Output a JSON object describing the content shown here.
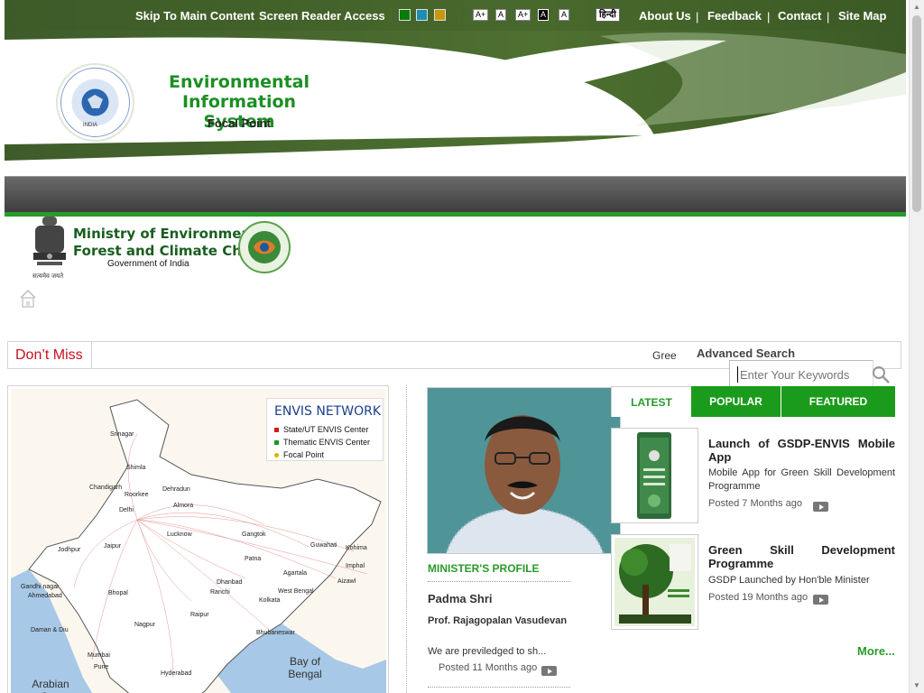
{
  "topbar": {
    "skip": "Skip To Main Content",
    "screen_reader": "Screen Reader Access",
    "themes": [
      "#0a7a0a",
      "#1a8fb0",
      "#c8960e"
    ],
    "font_controls": [
      "A+",
      "A",
      "A+",
      "A",
      "A"
    ],
    "hindi": "हिन्दी",
    "links": [
      "About Us",
      "Feedback",
      "Contact",
      "Site Map"
    ],
    "separator": "|"
  },
  "header": {
    "title": "Environmental Information System",
    "subtitle": "Focal Point",
    "logo_text": "Environmental Information System",
    "logo_country": "INDIA"
  },
  "ministry": {
    "name_line1": "Ministry of Environment,",
    "name_line2": "Forest and Climate Change",
    "government": "Government of India",
    "motto": "सत्यमेव जयते"
  },
  "dont_miss": {
    "label": "Don’t Miss",
    "ticker": "Gree"
  },
  "search": {
    "advanced": "Advanced Search",
    "placeholder": "Enter Your Keywords"
  },
  "map": {
    "legend_title": "ENVIS NETWORK",
    "legend": [
      {
        "label": "State/UT ENVIS Center",
        "color": "#d21a1a"
      },
      {
        "label": "Thematic ENVIS Center",
        "color": "#1a9a1a"
      },
      {
        "label": "Focal Point",
        "color": "#e0b000"
      }
    ],
    "cities": [
      "Srinagar",
      "Shimla",
      "Chandigarh",
      "Dehradun",
      "Roorkee",
      "Almora",
      "Delhi",
      "Jodhpur",
      "Jaipur",
      "Lucknow",
      "Gangtok",
      "Guwahati",
      "Kohima",
      "Patna",
      "Imphal",
      "Agartala",
      "Aizawl",
      "Gandhi nagar",
      "Ahmedabad",
      "Bhopal",
      "Dhanbad",
      "Ranchi",
      "West Bengal",
      "Kolkata",
      "Raipur",
      "Nagpur",
      "Bhubaneswar",
      "Daman & Diu",
      "Mumbai",
      "Pune",
      "Hyderabad"
    ],
    "seas": [
      "Bay of Bengal",
      "Arabian Sea"
    ]
  },
  "minister": {
    "section_label": "MINISTER'S PROFILE",
    "title": "Padma Shri",
    "name": "Prof. Rajagopalan Vasudevan",
    "desc": "We are previledged to sh...",
    "posted": "Posted 11 Months ago"
  },
  "tabs": [
    "LATEST",
    "POPULAR",
    "FEATURED"
  ],
  "news": [
    {
      "title": "Launch of GSDP-ENVIS Mobile App",
      "desc": "Mobile App for Green Skill Development Programme",
      "posted": "Posted 7 Months ago"
    },
    {
      "title": "Green Skill Development Programme",
      "desc": "GSDP Launched by Hon'ble Minister",
      "posted": "Posted 19 Months ago"
    }
  ],
  "more": "More..."
}
